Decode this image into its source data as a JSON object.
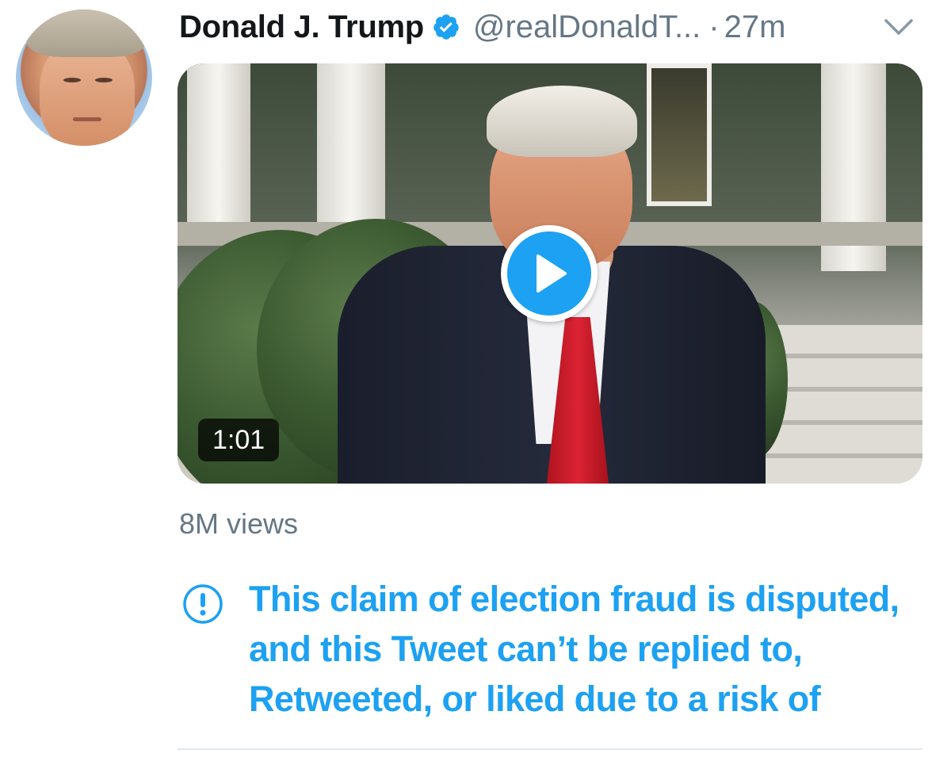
{
  "tweet": {
    "author": {
      "display_name": "Donald J. Trump",
      "handle": "@realDonaldT...",
      "verified": true
    },
    "separator": "·",
    "timestamp": "27m",
    "media": {
      "type": "video",
      "duration": "1:01"
    },
    "views": "8M views",
    "notice": {
      "icon": "exclamation-circle-icon",
      "text": "This claim of election fraud is disputed, and this Tweet can’t be replied to, Retweeted, or liked due to a risk of"
    }
  },
  "colors": {
    "accent": "#1da1f2",
    "secondary_text": "#657786",
    "primary_text": "#14171a",
    "divider": "#e1e8ed"
  }
}
